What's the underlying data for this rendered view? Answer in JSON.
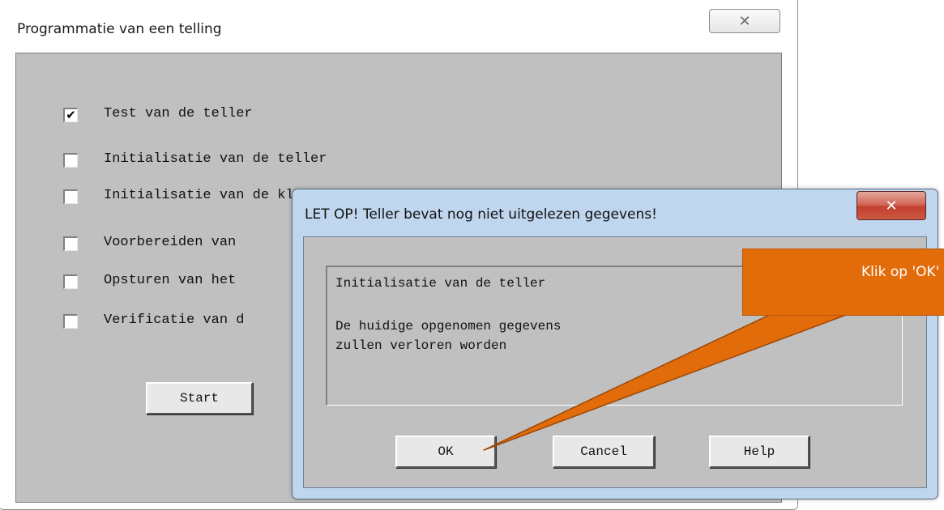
{
  "main_window": {
    "title": "Programmatie van een telling",
    "close_glyph": "✕",
    "options": [
      {
        "label": "Test van de teller",
        "checked": true
      },
      {
        "label": "Initialisatie van de teller",
        "checked": false
      },
      {
        "label": "Initialisatie van de klok",
        "checked": false
      },
      {
        "label": "Voorbereiden van",
        "checked": false
      },
      {
        "label": "Opsturen van het",
        "checked": false
      },
      {
        "label": "Verificatie van d",
        "checked": false
      }
    ],
    "start_label": "Start"
  },
  "dialog": {
    "title": "LET OP! Teller bevat nog niet uitgelezen gegevens!",
    "close_glyph": "✕",
    "message": {
      "line1": "Initialisatie van de teller",
      "line2": "De huidige opgenomen gegevens",
      "line3": "zullen verloren worden"
    },
    "ok_label": "OK",
    "cancel_label": "Cancel",
    "help_label": "Help"
  },
  "callout": {
    "text": "Klik op 'OK'",
    "color": "#e36c0a"
  }
}
